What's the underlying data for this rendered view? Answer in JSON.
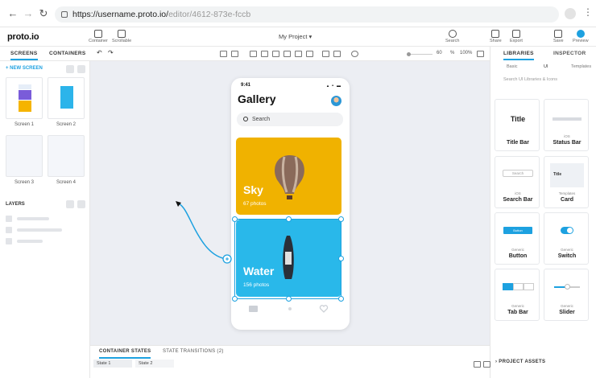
{
  "browser": {
    "url_base": "https://username.proto.io/",
    "url_rest": "editor/4612-873e-fccb"
  },
  "app": {
    "logo": "proto.io",
    "project_title": "My Project ▾"
  },
  "toolbar": {
    "container": "Container",
    "scrollable": "Scrollable",
    "search": "Search",
    "share": "Share",
    "export": "Export",
    "save": "Save",
    "preview": "Preview"
  },
  "left_panel": {
    "tabs": [
      "SCREENS",
      "CONTAINERS"
    ],
    "new_screen": "+ NEW SCREEN",
    "screens": [
      "Screen 1",
      "Screen 2",
      "Screen 3",
      "Screen 4"
    ],
    "layers_label": "LAYERS"
  },
  "zoom": {
    "value": "60",
    "pct": "%",
    "fit": "100%"
  },
  "phone": {
    "time": "9:41",
    "status": "▴ ◓ ▬",
    "title": "Gallery",
    "search_placeholder": "Search",
    "cards": [
      {
        "title": "Sky",
        "count": "67 photos"
      },
      {
        "title": "Water",
        "count": "156 photos"
      }
    ]
  },
  "right_panel": {
    "tabs": [
      "LIBRARIES",
      "INSPECTOR"
    ],
    "subtabs": [
      "Basic",
      "UI",
      "Templates"
    ],
    "search_placeholder": "Search UI Libraries & Icons",
    "items": [
      {
        "category": "",
        "name": "Title Bar",
        "preview": "Title"
      },
      {
        "category": "iOS",
        "name": "Status Bar",
        "preview": ""
      },
      {
        "category": "iOS",
        "name": "Search Bar",
        "preview": "Search"
      },
      {
        "category": "Templates",
        "name": "Card",
        "preview": "Title"
      },
      {
        "category": "Generic",
        "name": "Button",
        "preview": "Button"
      },
      {
        "category": "Generic",
        "name": "Switch",
        "preview": ""
      },
      {
        "category": "Generic",
        "name": "Tab Bar",
        "preview": ""
      },
      {
        "category": "Generic",
        "name": "Slider",
        "preview": ""
      }
    ],
    "project_assets": "› PROJECT ASSETS"
  },
  "bottom": {
    "tabs": [
      "CONTAINER STATES",
      "STATE TRANSITIONS (2)"
    ],
    "states": [
      "State 1",
      "State 2"
    ]
  },
  "colors": {
    "accent": "#1da1e0",
    "sky": "#f0b200",
    "water": "#29b8ea"
  }
}
